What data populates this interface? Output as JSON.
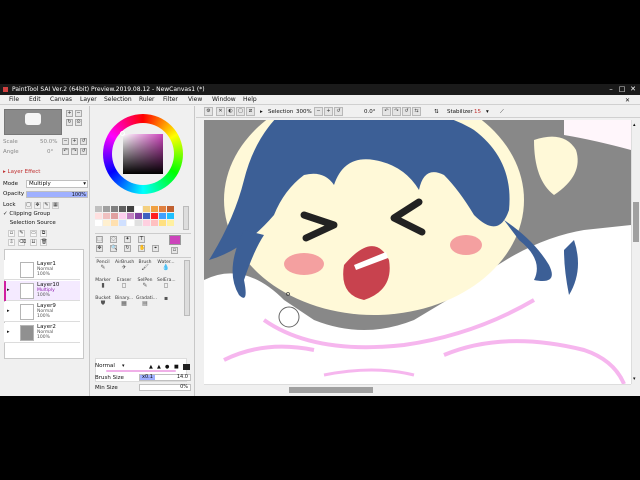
{
  "window": {
    "title": "PaintTool SAI Ver.2 (64bit) Preview.2019.08.12 - NewCanvas1 (*)",
    "minimize": "–",
    "maximize": "□",
    "close": "✕"
  },
  "menu": [
    "File",
    "Edit",
    "Canvas",
    "Layer",
    "Selection",
    "Ruler",
    "Filter",
    "View",
    "Window",
    "Help"
  ],
  "navigator": {
    "scale_label": "Scale",
    "scale_value": "50.0%",
    "angle_label": "Angle",
    "angle_value": "0°"
  },
  "layer_panel": {
    "layer_effect": "Layer Effect",
    "mode_label": "Mode",
    "mode_value": "Multiply",
    "opacity_label": "Opacity",
    "opacity_value": "100%",
    "opacity_fraction": 1.0,
    "lock_label": "Lock",
    "clipping_group": "Clipping Group",
    "clipping_checked": true,
    "selection_source": "Selection Source",
    "selection_source_checked": false,
    "layers": [
      {
        "name": "Layer1",
        "mode": "Normal",
        "opacity": "100%",
        "selected": false,
        "visible": false
      },
      {
        "name": "Layer10",
        "mode": "Multiply",
        "opacity": "100%",
        "selected": true,
        "visible": true
      },
      {
        "name": "Layer9",
        "mode": "Normal",
        "opacity": "100%",
        "selected": false,
        "visible": true
      },
      {
        "name": "Layer2",
        "mode": "Normal",
        "opacity": "100%",
        "selected": false,
        "visible": true
      }
    ]
  },
  "color_panel": {
    "current_color": "#cc44bb",
    "swatches": [
      "#c0c0c0",
      "#a0a0a0",
      "#808080",
      "#606060",
      "#404040",
      "#ffffff",
      "#f4d080",
      "#f0a040",
      "#e08040",
      "#c06030",
      "#ffe0e0",
      "#f0c0c0",
      "#e0a0a0",
      "#ffd0f0",
      "#c080c0",
      "#8040a0",
      "#4060c0",
      "#ff2020",
      "#40a0ff",
      "#20c0ff",
      "#ffffff",
      "#fff0d0",
      "#ffe0b0",
      "#d0e0ff",
      "#ffffff",
      "#e0e0e0",
      "#ffd0e0",
      "#ffc0c0",
      "#ffe080",
      "#fff0a0"
    ]
  },
  "tools": {
    "items": [
      {
        "label": "Pencil",
        "icon": "✎"
      },
      {
        "label": "AirBrush",
        "icon": "✈"
      },
      {
        "label": "Brush",
        "icon": "🖌"
      },
      {
        "label": "Water...",
        "icon": "💧"
      },
      {
        "label": "Marker",
        "icon": "▮"
      },
      {
        "label": "Eraser",
        "icon": "◻"
      },
      {
        "label": "SelPen",
        "icon": "✎"
      },
      {
        "label": "SelEra...",
        "icon": "◻"
      },
      {
        "label": "Bucket",
        "icon": "⛊"
      },
      {
        "label": "Binary...",
        "icon": "▦"
      },
      {
        "label": "Gradati...",
        "icon": "▤"
      },
      {
        "label": "",
        "icon": "▪"
      }
    ],
    "blend_mode": "Normal",
    "brush_size_label": "Brush Size",
    "brush_size_mult": "x0.1",
    "brush_size_value": "14.0",
    "min_size_label": "Min Size",
    "min_size_value": "0%"
  },
  "canvas_toolbar": {
    "selection_label": "Selection",
    "zoom": "300%",
    "angle": "0.0°",
    "stabilizer_label": "Stabilizer",
    "stabilizer_value": "15"
  }
}
